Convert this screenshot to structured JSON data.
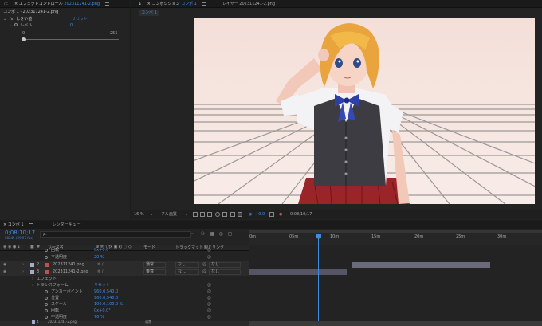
{
  "effect_controls": {
    "tab_number": "7c",
    "tab_label": "エフェクトコントロール",
    "tab_file": "202311241-2.png",
    "header": "コンポ 1 · 202311241-2.png",
    "effect_name": "しきい値",
    "reset_label": "リセット",
    "param_label": "レベル",
    "param_value": "0",
    "slider_min": "0",
    "slider_max": "255",
    "slider_value": 0
  },
  "viewer": {
    "tab_comp_label": "コンポジション",
    "tab_comp_name": "コンポ 1",
    "tab_layer_label": "レイヤー",
    "tab_layer_file": "202311241-2.png",
    "subtab": "コンポ 1",
    "zoom": "16 %",
    "quality": "フル画質",
    "exposure": "+0.0",
    "timecode": "0;08;10;17"
  },
  "timeline": {
    "tab_comp": "コンポ 1",
    "tab_render": "レンダーキュー",
    "timecode": "0;08;10;17",
    "frames": "00245 (29.97 fps)",
    "search_placeholder": "ρ.",
    "headers": {
      "source_name": "ソース名",
      "mode": "モード",
      "trackmat": "トラックマット",
      "parent": "親とリンク"
    },
    "ruler": [
      "0m",
      "05m",
      "10m",
      "15m",
      "20m",
      "25m",
      "30m"
    ],
    "rows": [
      {
        "label": "回転",
        "value": "0x+0.0°"
      },
      {
        "label": "不透明度",
        "value": "20 %"
      },
      {
        "num": "2",
        "name": "202311241.png",
        "mode": "通常",
        "trackmat": "なし",
        "parent": "なし"
      },
      {
        "num": "3",
        "name": "202311241-2.png",
        "mode": "乗算",
        "trackmat": "なし",
        "parent": "なし"
      },
      {
        "label": "エフェクト"
      },
      {
        "label": "トランスフォーム",
        "value": "リセット"
      },
      {
        "label": "アンカーポイント",
        "value": "960.0,540.0"
      },
      {
        "label": "位置",
        "value": "960.0,540.0"
      },
      {
        "label": "スケール",
        "value": "100.0,100.0 %"
      },
      {
        "label": "回転",
        "value": "0x+0.0°"
      },
      {
        "label": "不透明度",
        "value": "76 %"
      }
    ],
    "bottom_row": {
      "num": "4",
      "name": "202311241-2.png",
      "mode": "通常"
    }
  },
  "colors": {
    "accent": "#3c8ce6",
    "layer_label": "#a9a9c8",
    "playhead": "#3c8ce6",
    "bar_gray": "#5e5e6e",
    "canvas_bg": "#f3e1da"
  }
}
